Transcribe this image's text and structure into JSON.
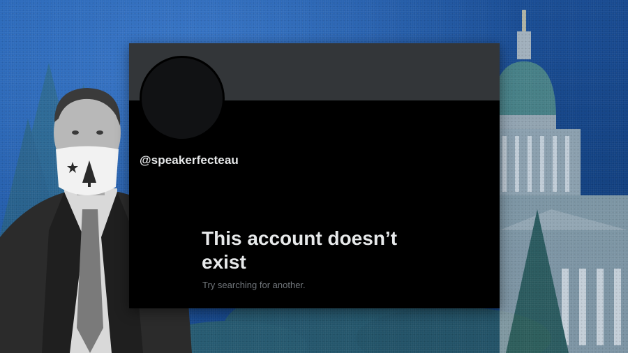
{
  "profile": {
    "handle": "@speakerfecteau",
    "message_title": "This account doesn’t exist",
    "message_subtitle": "Try searching for another."
  },
  "colors": {
    "background_blue": "#1b4f9a",
    "card_background": "#000000",
    "banner_gray": "#333639",
    "primary_text": "#e7e9ea",
    "secondary_text": "#71767b"
  },
  "icons": {
    "mask_emblem": "pine-tree-star-icon",
    "lapel_pin": "state-seal-pin-icon"
  }
}
